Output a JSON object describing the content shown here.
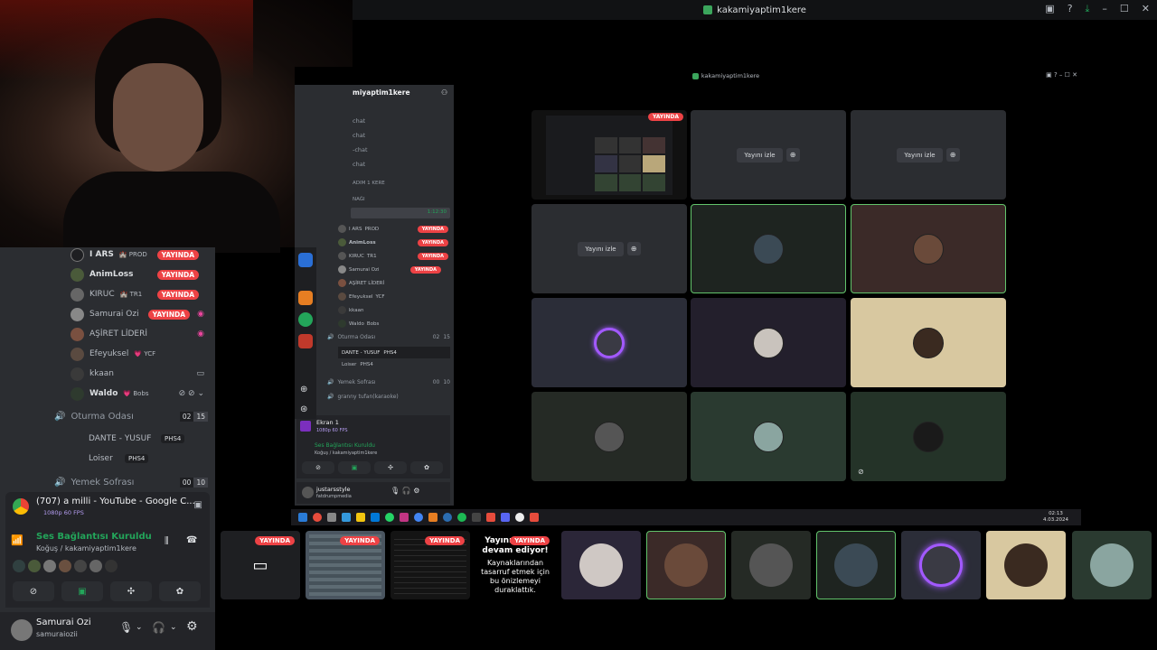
{
  "window": {
    "title": "kakamiyaptim1kere",
    "inner_title": "kakamiyaptim1kere"
  },
  "left": {
    "voice_users": [
      {
        "name": "I ARS",
        "tag": "🏰 PROD",
        "live": "YAYINDA"
      },
      {
        "name": "AnimLoss",
        "tag": "",
        "live": "YAYINDA"
      },
      {
        "name": "KIRUC",
        "tag": "🏰 TR1",
        "live": "YAYINDA"
      },
      {
        "name": "Samurai Ozi",
        "tag": "",
        "live": "YAYINDA"
      },
      {
        "name": "AŞİRET LİDERİ",
        "tag": "",
        "live": ""
      },
      {
        "name": "Efeyuksel",
        "tag": "💗 YCF",
        "live": ""
      },
      {
        "name": "kkaan",
        "tag": "",
        "live": ""
      },
      {
        "name": "Waldo",
        "tag": "💗 Bobs",
        "live": ""
      }
    ],
    "channel_oturma": {
      "name": "Oturma Odası",
      "count_a": "02",
      "count_b": "15"
    },
    "oturma_users": [
      {
        "name": "DANTE - YUSUF",
        "tag": "PHS4"
      },
      {
        "name": "Loiser",
        "tag": "PHS4"
      }
    ],
    "channel_yemek": {
      "name": "Yemek Sofrası",
      "count_a": "00",
      "count_b": "10"
    },
    "chrome_popup": {
      "title": "(707) a milli - YouTube - Google C...",
      "subtitle": "1080p 60 FPS"
    },
    "voice_panel": {
      "status": "Ses Bağlantısı Kuruldu",
      "location": "Koğuş / kakamiyaptim1kere"
    },
    "user_panel": {
      "name": "Samurai Ozi",
      "handle": "samuraiozii"
    }
  },
  "inner": {
    "server_name": "miyaptim1kere",
    "channels": [
      "chat",
      "chat",
      "-chat",
      "chat"
    ],
    "category_a": "ADIM 1 KERE",
    "category_b": "NAĞI",
    "voice_time": "1:12:30",
    "users": [
      {
        "name": "I ARS",
        "tag": "PROD",
        "live": "YAYINDA"
      },
      {
        "name": "AnimLoss",
        "tag": "",
        "live": "YAYINDA"
      },
      {
        "name": "KIRUC",
        "tag": "TR1",
        "live": "YAYINDA"
      },
      {
        "name": "Samurai Ozi",
        "tag": "",
        "live": "YAYINDA"
      },
      {
        "name": "AŞİRET LİDERİ",
        "tag": "",
        "live": ""
      },
      {
        "name": "Efeyuksel",
        "tag": "YCF",
        "live": ""
      },
      {
        "name": "kkaan",
        "tag": "",
        "live": ""
      },
      {
        "name": "Waldo",
        "tag": "Bobs",
        "live": ""
      }
    ],
    "oturma": "Oturma Odası",
    "oturma_a": "02",
    "oturma_b": "15",
    "oturma_users": [
      {
        "name": "DANTE - YUSUF",
        "tag": "PHS4"
      },
      {
        "name": "Loiser",
        "tag": "PHS4"
      }
    ],
    "yemek": "Yemek Sofrası",
    "yemek_a": "00",
    "yemek_b": "10",
    "granny": "granny tufan(karaoke)",
    "screen": {
      "title": "Ekran 1",
      "sub": "1080p 60 FPS"
    },
    "voice": {
      "status": "Ses Bağlantısı Kuruldu",
      "location": "Koğuş / kakamiyaptim1kere"
    },
    "user": {
      "name": "justarsstyle",
      "handle": "fatdrumpmedia"
    },
    "watch_label": "Yayını izle",
    "live_badge": "YAYINDA"
  },
  "taskbar": {
    "time": "02:13",
    "date": "4.03.2024"
  },
  "bottom": {
    "live_badge": "YAYINDA",
    "paused_title": "Yayının halen devam ediyor!",
    "paused_text": "Kaynaklarından tasarruf etmek için bu önizlemeyi duraklattık."
  },
  "colors": {
    "live": "#ed4245",
    "connected": "#23a55a",
    "selected_border": "#62c46b",
    "sidebar": "#2b2d31"
  }
}
